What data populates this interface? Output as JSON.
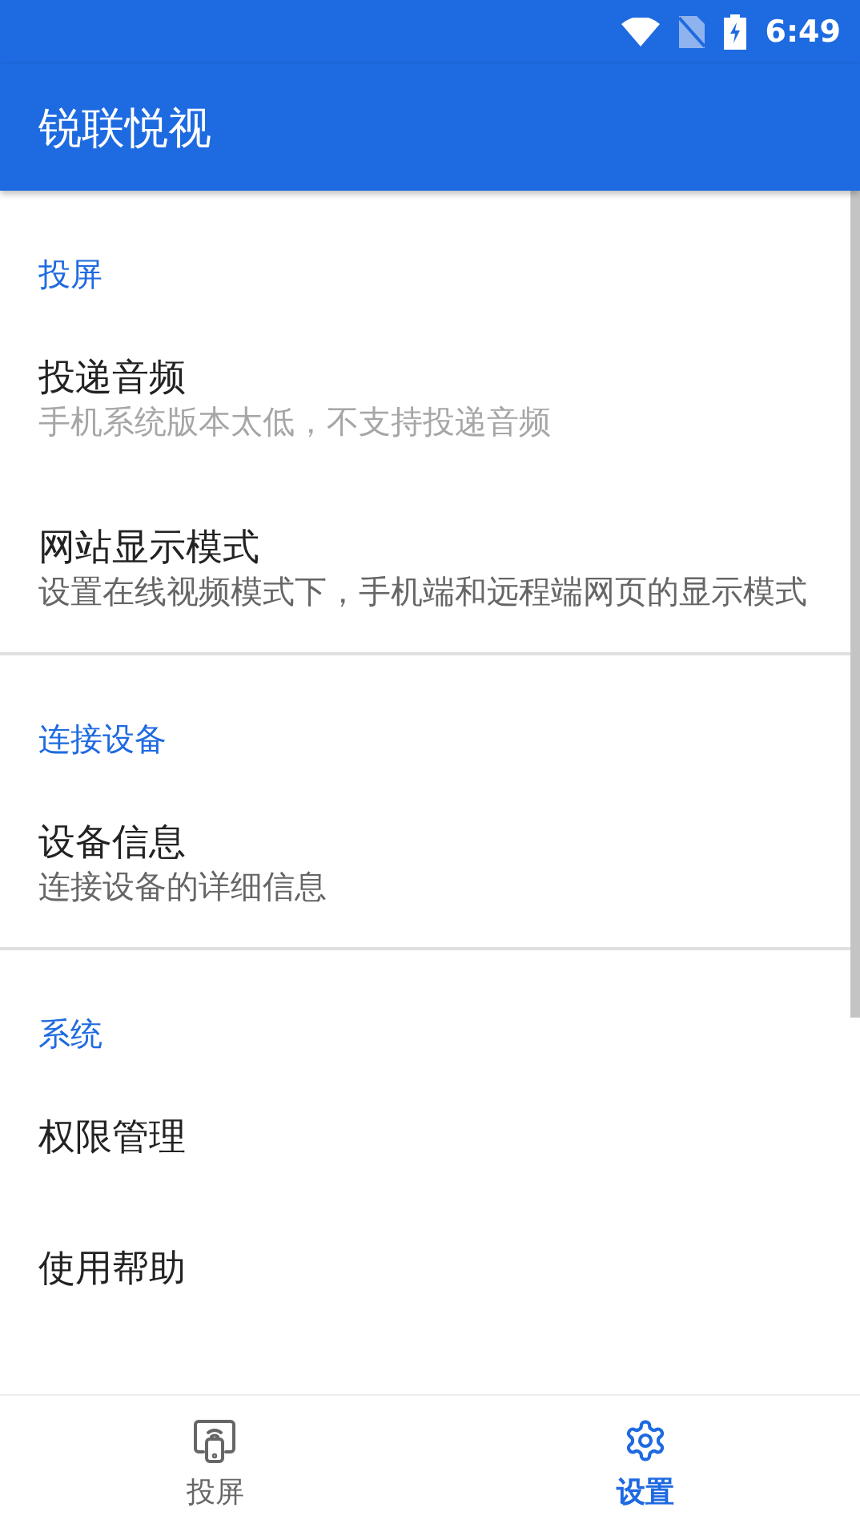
{
  "status_bar": {
    "time": "6:49"
  },
  "app_bar": {
    "title": "锐联悦视"
  },
  "sections": [
    {
      "title": "投屏",
      "items": [
        {
          "title": "投递音频",
          "summary": "手机系统版本太低，不支持投递音频",
          "disabled": true
        },
        {
          "title": "网站显示模式",
          "summary": "设置在线视频模式下，手机端和远程端网页的显示模式",
          "disabled": false
        }
      ]
    },
    {
      "title": "连接设备",
      "items": [
        {
          "title": "设备信息",
          "summary": "连接设备的详细信息",
          "disabled": false
        }
      ]
    },
    {
      "title": "系统",
      "items": [
        {
          "title": "权限管理"
        },
        {
          "title": "使用帮助"
        }
      ]
    }
  ],
  "bottom_nav": [
    {
      "kind": "cast",
      "label": "投屏",
      "selected": false
    },
    {
      "kind": "settings",
      "label": "设置",
      "selected": true
    }
  ]
}
